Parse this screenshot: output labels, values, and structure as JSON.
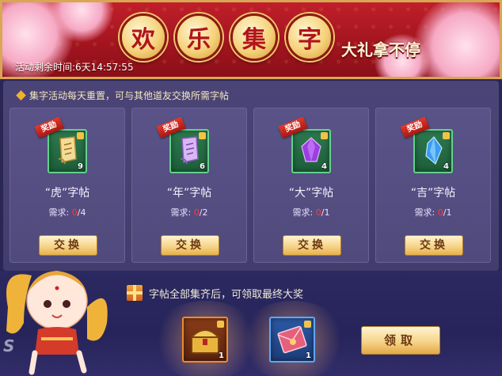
{
  "banner": {
    "title_chars": [
      "欢",
      "乐",
      "集",
      "字"
    ],
    "subtitle": "大礼拿不停",
    "timer_label": "活动剩余时间:",
    "timer_value": "6天14:57:55"
  },
  "notice": "集字活动每天重置，可与其他道友交换所需字帖",
  "cards": [
    {
      "reward_tag": "奖励",
      "item_icon": "tiger-scroll-icon",
      "count": "9",
      "name": "“虎”字帖",
      "need_label": "需求:",
      "need_have": "0",
      "need_total": "/4",
      "button": "交换"
    },
    {
      "reward_tag": "奖励",
      "item_icon": "year-scroll-icon",
      "count": "6",
      "name": "“年”字帖",
      "need_label": "需求:",
      "need_have": "0",
      "need_total": "/2",
      "button": "交换"
    },
    {
      "reward_tag": "奖励",
      "item_icon": "purple-gem-icon",
      "count": "4",
      "name": "“大”字帖",
      "need_label": "需求:",
      "need_have": "0",
      "need_total": "/1",
      "button": "交换"
    },
    {
      "reward_tag": "奖励",
      "item_icon": "blue-crystal-icon",
      "count": "4",
      "name": "“吉”字帖",
      "need_label": "需求:",
      "need_have": "0",
      "need_total": "/1",
      "button": "交换"
    }
  ],
  "final_reward": {
    "hint": "字帖全部集齐后，可领取最终大奖",
    "items": [
      {
        "icon": "treasure-chest-icon",
        "count": "1"
      },
      {
        "icon": "red-envelope-icon",
        "count": "1"
      }
    ],
    "claim_button": "领取"
  },
  "colors": {
    "banner_red": "#a3151f",
    "gold_accent": "#f6d48a",
    "panel_purple": "#4b4577",
    "need_red": "#ff3b30"
  }
}
